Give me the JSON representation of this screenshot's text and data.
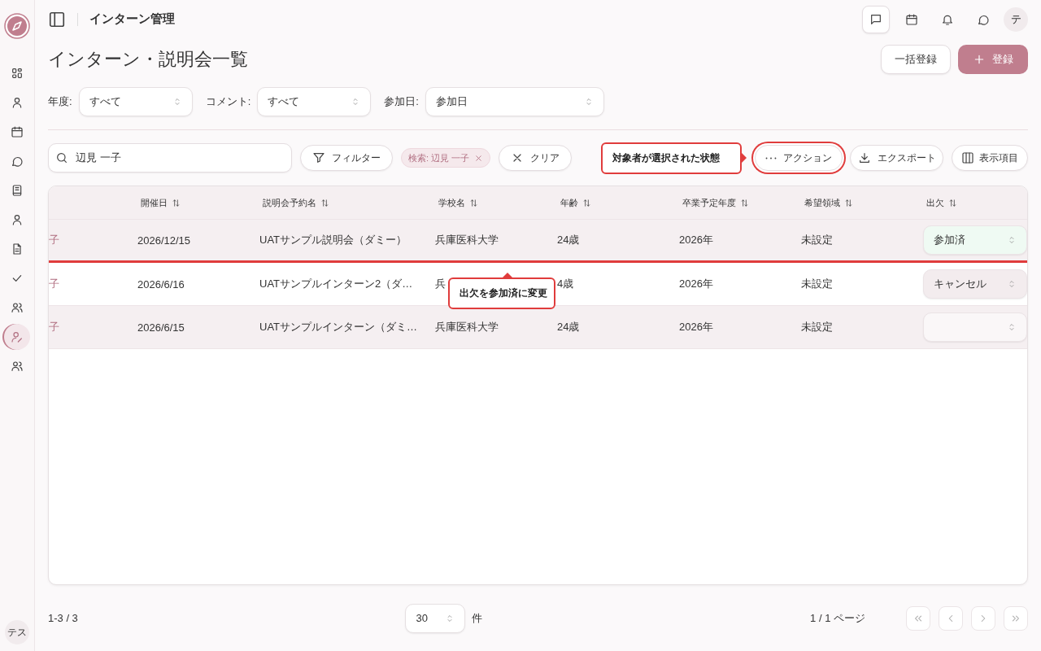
{
  "sidebar": {
    "items": [
      {
        "kind": "grid",
        "selected": false
      },
      {
        "kind": "user",
        "selected": false
      },
      {
        "kind": "calendar",
        "selected": false
      },
      {
        "kind": "chat",
        "selected": false
      },
      {
        "kind": "book",
        "selected": false
      },
      {
        "kind": "user",
        "selected": false
      },
      {
        "kind": "document",
        "selected": false
      },
      {
        "kind": "check",
        "selected": false
      },
      {
        "kind": "users",
        "selected": false
      },
      {
        "kind": "useredit",
        "selected": true
      },
      {
        "kind": "users",
        "selected": false
      }
    ],
    "avatar": "テス"
  },
  "header": {
    "title": "インターン管理",
    "avatar": "テ",
    "icons": [
      {
        "kind": "message",
        "selected": true
      },
      {
        "kind": "calendar",
        "selected": false
      },
      {
        "kind": "bell",
        "selected": false
      },
      {
        "kind": "chat",
        "selected": false
      }
    ]
  },
  "page": {
    "title": "インターン・説明会一覧",
    "buttons": [
      {
        "label": "一括登録",
        "kind": "secondary"
      },
      {
        "label": "登録",
        "kind": "primary"
      }
    ]
  },
  "filters": [
    {
      "label": "年度:",
      "value": "すべて"
    },
    {
      "label": "コメント:",
      "value": "すべて"
    },
    {
      "label": "参加日:",
      "value": "参加日"
    }
  ],
  "toolbar": {
    "search": {
      "value": "辺見 一子"
    },
    "filter_button": "フィルター",
    "chip": "検索: 辺見 一子",
    "clear_button": "クリア",
    "action_button": {
      "label": "アクション",
      "highlighted": true
    },
    "export_button": "エクスポート",
    "columns_button": "表示項目"
  },
  "table": {
    "columns": [
      "",
      "開催日",
      "説明会予約名",
      "学校名",
      "年齢",
      "卒業予定年度",
      "希望領域",
      "出欠"
    ],
    "rows": [
      {
        "cells": [
          "子",
          "2026/12/15",
          "UATサンプル説明会（ダミー）",
          "兵庫医科大学",
          "24歳",
          "2026年",
          "未設定"
        ],
        "attendance": {
          "value": "参加済",
          "kind": "attended"
        },
        "highlighted": true
      },
      {
        "cells": [
          "子",
          "2026/6/16",
          "UATサンプルインターン2（ダ…",
          "兵",
          "4歳",
          "2026年",
          "未設定"
        ],
        "attendance": {
          "value": "キャンセル",
          "kind": "cancelled"
        },
        "highlighted": false
      },
      {
        "cells": [
          "子",
          "2026/6/15",
          "UATサンプルインターン（ダミ…",
          "兵庫医科大学",
          "24歳",
          "2026年",
          "未設定"
        ],
        "attendance": {
          "kind": "none"
        },
        "highlighted": false
      }
    ]
  },
  "annotations": [
    {
      "text": "対象者が選択された状態",
      "kind": "callout"
    },
    {
      "text": "出欠を参加済に変更",
      "kind": "tooltip"
    }
  ],
  "footer": {
    "range": "1-3 / 3",
    "page_size": "30",
    "unit": "件",
    "page_info": "1 / 1 ページ"
  }
}
